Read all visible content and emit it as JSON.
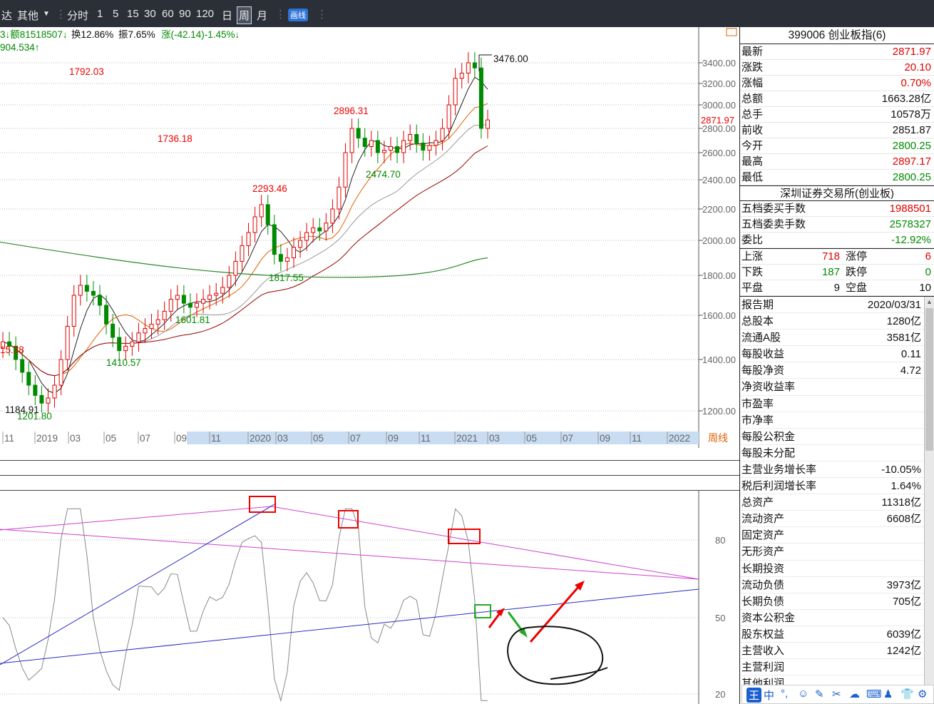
{
  "toolbar": {
    "app_fragment": "达",
    "other": "其他",
    "periods": [
      "分时",
      "1",
      "5",
      "15",
      "30",
      "60",
      "90",
      "120",
      "日",
      "周",
      "月"
    ],
    "selected_period": "周",
    "draw_button": "画线",
    "sep": "⋮"
  },
  "infobar": {
    "amount": "3↓额81518507↓",
    "turnover": "换12.86%",
    "amplitude": "振7.65%",
    "change": "涨(-42.14)-1.45%↓",
    "line2": "904.534↑"
  },
  "chart_data": {
    "type": "candlestick",
    "frequency": "weekly",
    "period_label": "周线",
    "price_ticks": [
      3400,
      3200,
      3000,
      2800,
      2600,
      2400,
      2200,
      2000,
      1800,
      1600,
      1400,
      1200
    ],
    "tick_labels": [
      "3400.00",
      "3200.00",
      "3000.00",
      "2800.00",
      "2600.00",
      "2400.00",
      "2200.00",
      "2000.00",
      "1800.00",
      "1600.00",
      "1400.00",
      "1200.00"
    ],
    "current_price_label": "2871.97",
    "annotations": [
      {
        "label": "3476.00",
        "value": 3476,
        "kind": "high"
      },
      {
        "label": "2896.31",
        "value": 2896.31,
        "kind": "high"
      },
      {
        "label": "2474.70",
        "value": 2474.7,
        "kind": "low"
      },
      {
        "label": "2293.46",
        "value": 2293.46,
        "kind": "high"
      },
      {
        "label": "1817.55",
        "value": 1817.55,
        "kind": "low"
      },
      {
        "label": "1792.03",
        "value": 1792.03,
        "kind": "high"
      },
      {
        "label": "1736.18",
        "value": 1736.18,
        "kind": "high"
      },
      {
        "label": "1601.81",
        "value": 1601.81,
        "kind": "low"
      },
      {
        "label": "1410.57",
        "value": 1410.57,
        "kind": "low"
      },
      {
        "label": "15.38",
        "value": 1515.38,
        "kind": "high"
      },
      {
        "label": "1184.91",
        "value": 1184.91,
        "kind": "low"
      },
      {
        "label": "1201.80",
        "value": 1201.8,
        "kind": "low"
      }
    ],
    "x_labels": [
      "11",
      "2019",
      "03",
      "05",
      "07",
      "09",
      "11",
      "2020",
      "03",
      "05",
      "07",
      "09",
      "11",
      "2021",
      "03",
      "05",
      "07",
      "09",
      "11",
      "2022"
    ],
    "closes": [
      1480,
      1460,
      1400,
      1350,
      1300,
      1260,
      1230,
      1250,
      1300,
      1400,
      1550,
      1700,
      1750,
      1720,
      1700,
      1650,
      1560,
      1500,
      1440,
      1460,
      1480,
      1520,
      1540,
      1560,
      1580,
      1620,
      1680,
      1700,
      1660,
      1640,
      1660,
      1680,
      1700,
      1710,
      1740,
      1800,
      1880,
      1970,
      2050,
      2150,
      2230,
      2100,
      1920,
      1880,
      1900,
      1960,
      2000,
      2050,
      2080,
      2060,
      2110,
      2200,
      2350,
      2600,
      2800,
      2720,
      2650,
      2700,
      2600,
      2620,
      2650,
      2600,
      2700,
      2750,
      2680,
      2620,
      2660,
      2700,
      2800,
      3000,
      3250,
      3300,
      3400,
      3350,
      2800,
      2871.97
    ],
    "ma_green": {
      "start": 1990,
      "end": 1900
    },
    "indicator": {
      "ticks": [
        80,
        50,
        20
      ],
      "tick_labels": [
        "80",
        "50",
        "20"
      ]
    }
  },
  "right_panel": {
    "title": "399006 创业板指(6)",
    "quote": [
      {
        "label": "最新",
        "value": "2871.97",
        "color": "red"
      },
      {
        "label": "涨跌",
        "value": "20.10",
        "color": "red"
      },
      {
        "label": "涨幅",
        "value": "0.70%",
        "color": "red"
      },
      {
        "label": "总额",
        "value": "1663.28亿",
        "color": "blk"
      },
      {
        "label": "总手",
        "value": "10578万",
        "color": "blk"
      },
      {
        "label": "前收",
        "value": "2851.87",
        "color": "blk"
      },
      {
        "label": "今开",
        "value": "2800.25",
        "color": "green"
      },
      {
        "label": "最高",
        "value": "2897.17",
        "color": "red"
      },
      {
        "label": "最低",
        "value": "2800.25",
        "color": "green"
      }
    ],
    "exchange": "深圳证券交易所(创业板)",
    "orders": [
      {
        "label": "五档委买手数",
        "value": "1988501",
        "color": "red"
      },
      {
        "label": "五档委卖手数",
        "value": "2578327",
        "color": "green"
      },
      {
        "label": "委比",
        "value": "-12.92%",
        "color": "green"
      }
    ],
    "breadth": [
      {
        "l1": "上涨",
        "v1": "718",
        "c1": "red",
        "l2": "涨停",
        "v2": "6",
        "c2": "red"
      },
      {
        "l1": "下跌",
        "v1": "187",
        "c1": "green",
        "l2": "跌停",
        "v2": "0",
        "c2": "green"
      },
      {
        "l1": "平盘",
        "v1": "9",
        "c1": "blk",
        "l2": "空盘",
        "v2": "10",
        "c2": "blk"
      }
    ],
    "financials": [
      {
        "label": "报告期",
        "value": "2020/03/31"
      },
      {
        "label": "总股本",
        "value": "1280亿"
      },
      {
        "label": "流通A股",
        "value": "3581亿"
      },
      {
        "label": "每股收益",
        "value": "0.11"
      },
      {
        "label": "每股净资",
        "value": "4.72"
      },
      {
        "label": "净资收益率",
        "value": ""
      },
      {
        "label": "市盈率",
        "value": ""
      },
      {
        "label": "市净率",
        "value": ""
      },
      {
        "label": "每股公积金",
        "value": ""
      },
      {
        "label": "每股未分配",
        "value": ""
      },
      {
        "label": "主营业务增长率",
        "value": "-10.05%"
      },
      {
        "label": "税后利润增长率",
        "value": "1.64%"
      },
      {
        "label": "总资产",
        "value": "11318亿"
      },
      {
        "label": "流动资产",
        "value": "6608亿"
      },
      {
        "label": "固定资产",
        "value": ""
      },
      {
        "label": "无形资产",
        "value": ""
      },
      {
        "label": "长期投资",
        "value": ""
      },
      {
        "label": "流动负债",
        "value": "3973亿"
      },
      {
        "label": "长期负债",
        "value": "705亿"
      },
      {
        "label": "资本公积金",
        "value": ""
      },
      {
        "label": "股东权益",
        "value": "6039亿"
      },
      {
        "label": "主营收入",
        "value": "1242亿"
      },
      {
        "label": "主营利润",
        "value": ""
      },
      {
        "label": "其他利润",
        "value": ""
      }
    ]
  },
  "taskbar": {
    "items": [
      "王",
      "中",
      "°,",
      "☺",
      "✎",
      "✂",
      "☁",
      "⌨",
      "♟",
      "👕",
      "⚙"
    ]
  }
}
